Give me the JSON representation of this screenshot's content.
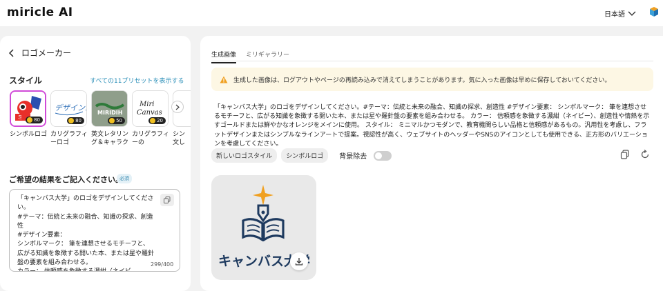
{
  "header": {
    "app_name": "miricle AI",
    "language": "日本語",
    "language_icon": "chevron-down-icon",
    "corner_icon": "cube-logo-icon"
  },
  "left": {
    "back_label": "ロゴメーカー",
    "style_label": "スタイル",
    "presets_link": "すべての11プリセットを表示する",
    "presets": [
      {
        "label1": "シンボルロゴ",
        "label2": "",
        "cost": "80",
        "selected": true
      },
      {
        "label1": "カリグラフィ",
        "label2": "ーロゴ",
        "cost": "80",
        "selected": false
      },
      {
        "label1": "英文レタリン",
        "label2": "グ＆キャラク",
        "cost": "50",
        "selected": false
      },
      {
        "label1": "カリグラフィ",
        "label2": "ーの",
        "cost": "20",
        "selected": false
      },
      {
        "label1": "シン",
        "label2": "文し",
        "cost": "",
        "selected": false
      }
    ],
    "thumb_texts": {
      "t2": "デザインが",
      "t3": "MIRIDIH",
      "t4_line1": "Miri",
      "t4_line2": "Canvas"
    },
    "next_icon": "chevron-right-icon",
    "prompt_label": "ご希望の結果をご記入ください。",
    "required_badge": "必須",
    "prompt_text": "「キャンバス大学」のロゴをデザインしてください。\n#テーマ：伝統と未来の融合、知識の探求、創造性\n#デザイン要素：\nシンボルマーク： 筆を連想させるモチーフと、広がる知識を象徴する開いた本、または星や羅針盤の要素を組み合わせる。\nカラー： 信頼感を象徴する濃紺（ネイビ",
    "counter": "299/400"
  },
  "right": {
    "tabs": [
      {
        "label": "生成画像",
        "active": true
      },
      {
        "label": "ミリギャラリー",
        "active": false
      }
    ],
    "warning": "生成した画像は、ログアウトやページの再読み込みで消えてしまうことがあります。気に入った画像は早めに保存しておいてください。",
    "prompt_echo": "「キャンバス大学」のロゴをデザインしてください。#テーマ：伝統と未来の融合、知識の探求、創造性 #デザイン要素： シンボルマーク： 筆を連想させるモチーフと、広がる知識を象徴する開いた本、または星や羅針盤の要素を組み合わせる。 カラー： 信頼感を象徴する濃紺（ネイビー）、創造性や情熱を示すゴールドまたは鮮やかなオレンジをメインに使用。 スタイル： ミニマルかつモダンで、教育機関らしい品格と信頼感があるもの。汎用性を考慮し、フラットデザインまたはシンプルなラインアートで提案。視認性が高く、ウェブサイトのヘッダーやSNSのアイコンとしても使用できる、正方形のバリエーションを考慮してください。",
    "chips": [
      "新しいロゴスタイル",
      "シンボルロゴ"
    ],
    "bg_remove_label": "背景除去",
    "bg_remove_on": false,
    "result_brand_text": "キャンバス大学",
    "colors": {
      "navy": "#1e3a5f",
      "gold": "#f0a020",
      "accent": "#2b8fb8"
    }
  }
}
